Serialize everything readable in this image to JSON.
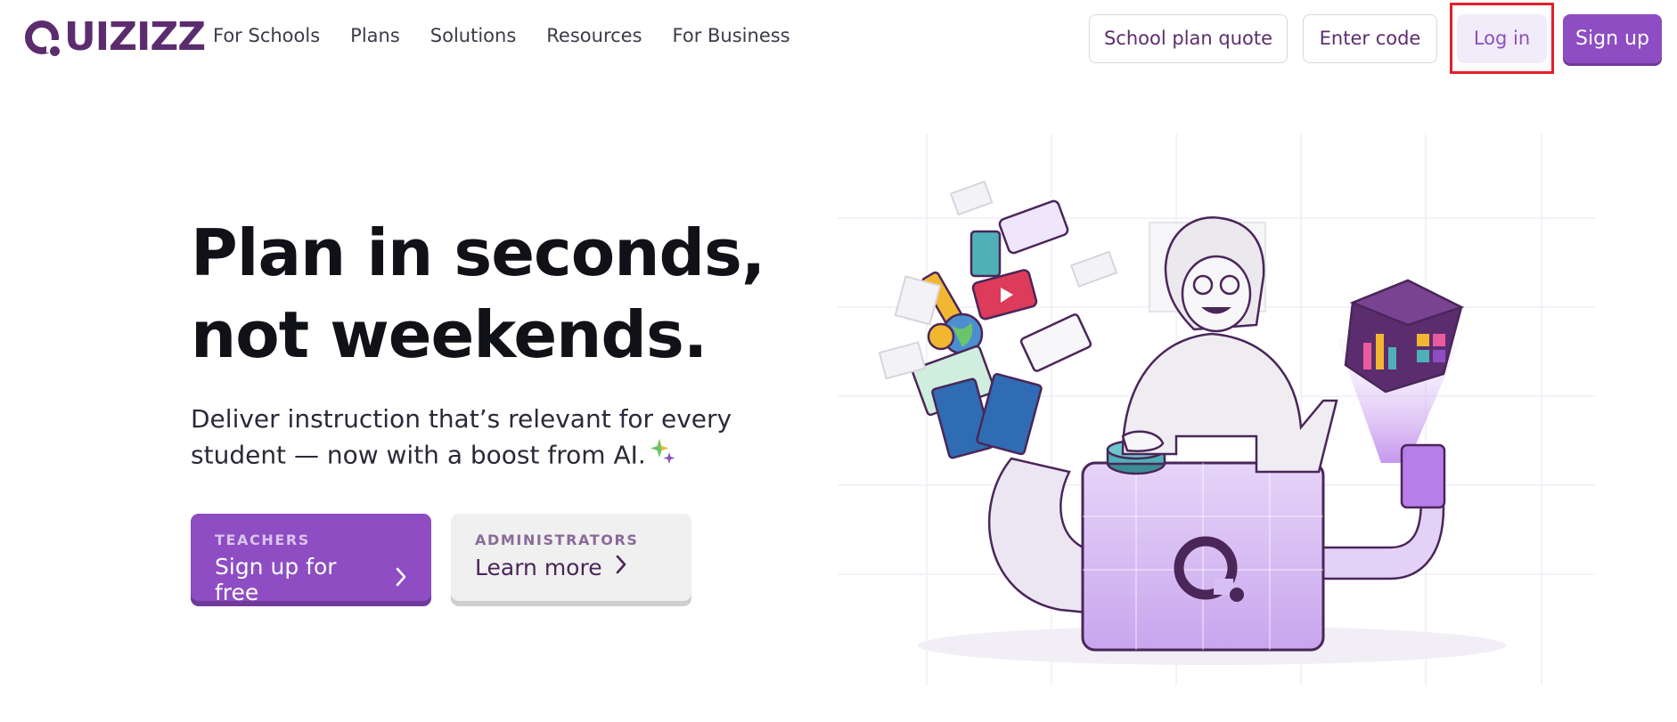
{
  "brand": {
    "name": "UIZIZZ",
    "accent": "#8e4dc2",
    "logo_color": "#5c2d6e",
    "highlight": "#e0202a"
  },
  "nav": {
    "links": [
      "For Schools",
      "Plans",
      "Solutions",
      "Resources",
      "For Business"
    ],
    "school_plan_quote": "School plan quote",
    "enter_code": "Enter code",
    "log_in": "Log in",
    "sign_up": "Sign up"
  },
  "hero": {
    "title_line1": "Plan in seconds,",
    "title_line2": "not weekends.",
    "subtitle": "Deliver instruction that’s relevant for every student — now with a boost from AI.",
    "sparkle_icon": "sparkle-icon"
  },
  "cta": {
    "teachers": {
      "kicker": "TEACHERS",
      "label": "Sign up for free",
      "icon": "chevron-right-icon"
    },
    "administrators": {
      "kicker": "ADMINISTRATORS",
      "label": "Learn more",
      "icon": "chevron-right-icon"
    }
  }
}
